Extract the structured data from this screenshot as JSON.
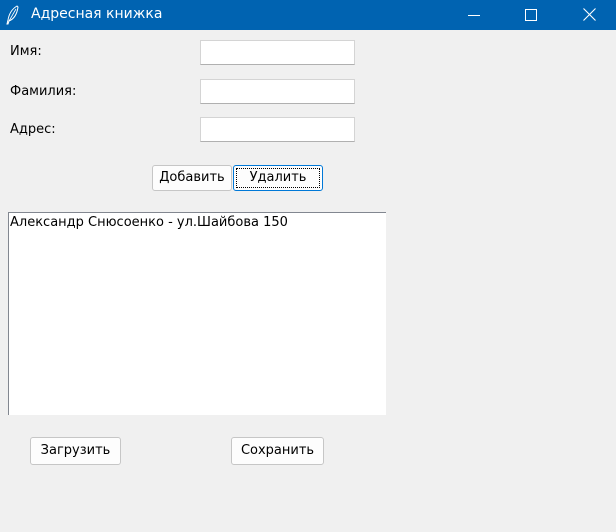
{
  "window": {
    "title": "Адресная книжка",
    "icon": "feather-icon",
    "titlebar_color": "#0063b1",
    "controls": [
      "minimize-icon",
      "maximize-icon",
      "close-icon"
    ]
  },
  "form": {
    "first_name_label": "Имя:",
    "first_name_value": "",
    "last_name_label": "Фамилия:",
    "last_name_value": "",
    "address_label": "Адрес:",
    "address_value": ""
  },
  "actions": {
    "add_label": "Добавить",
    "delete_label": "Удалить"
  },
  "contacts": {
    "items": [
      {
        "text": "Александр Снюсоенко - ул.Шайбова 150"
      }
    ]
  },
  "file": {
    "load_label": "Загрузить",
    "save_label": "Сохранить"
  }
}
